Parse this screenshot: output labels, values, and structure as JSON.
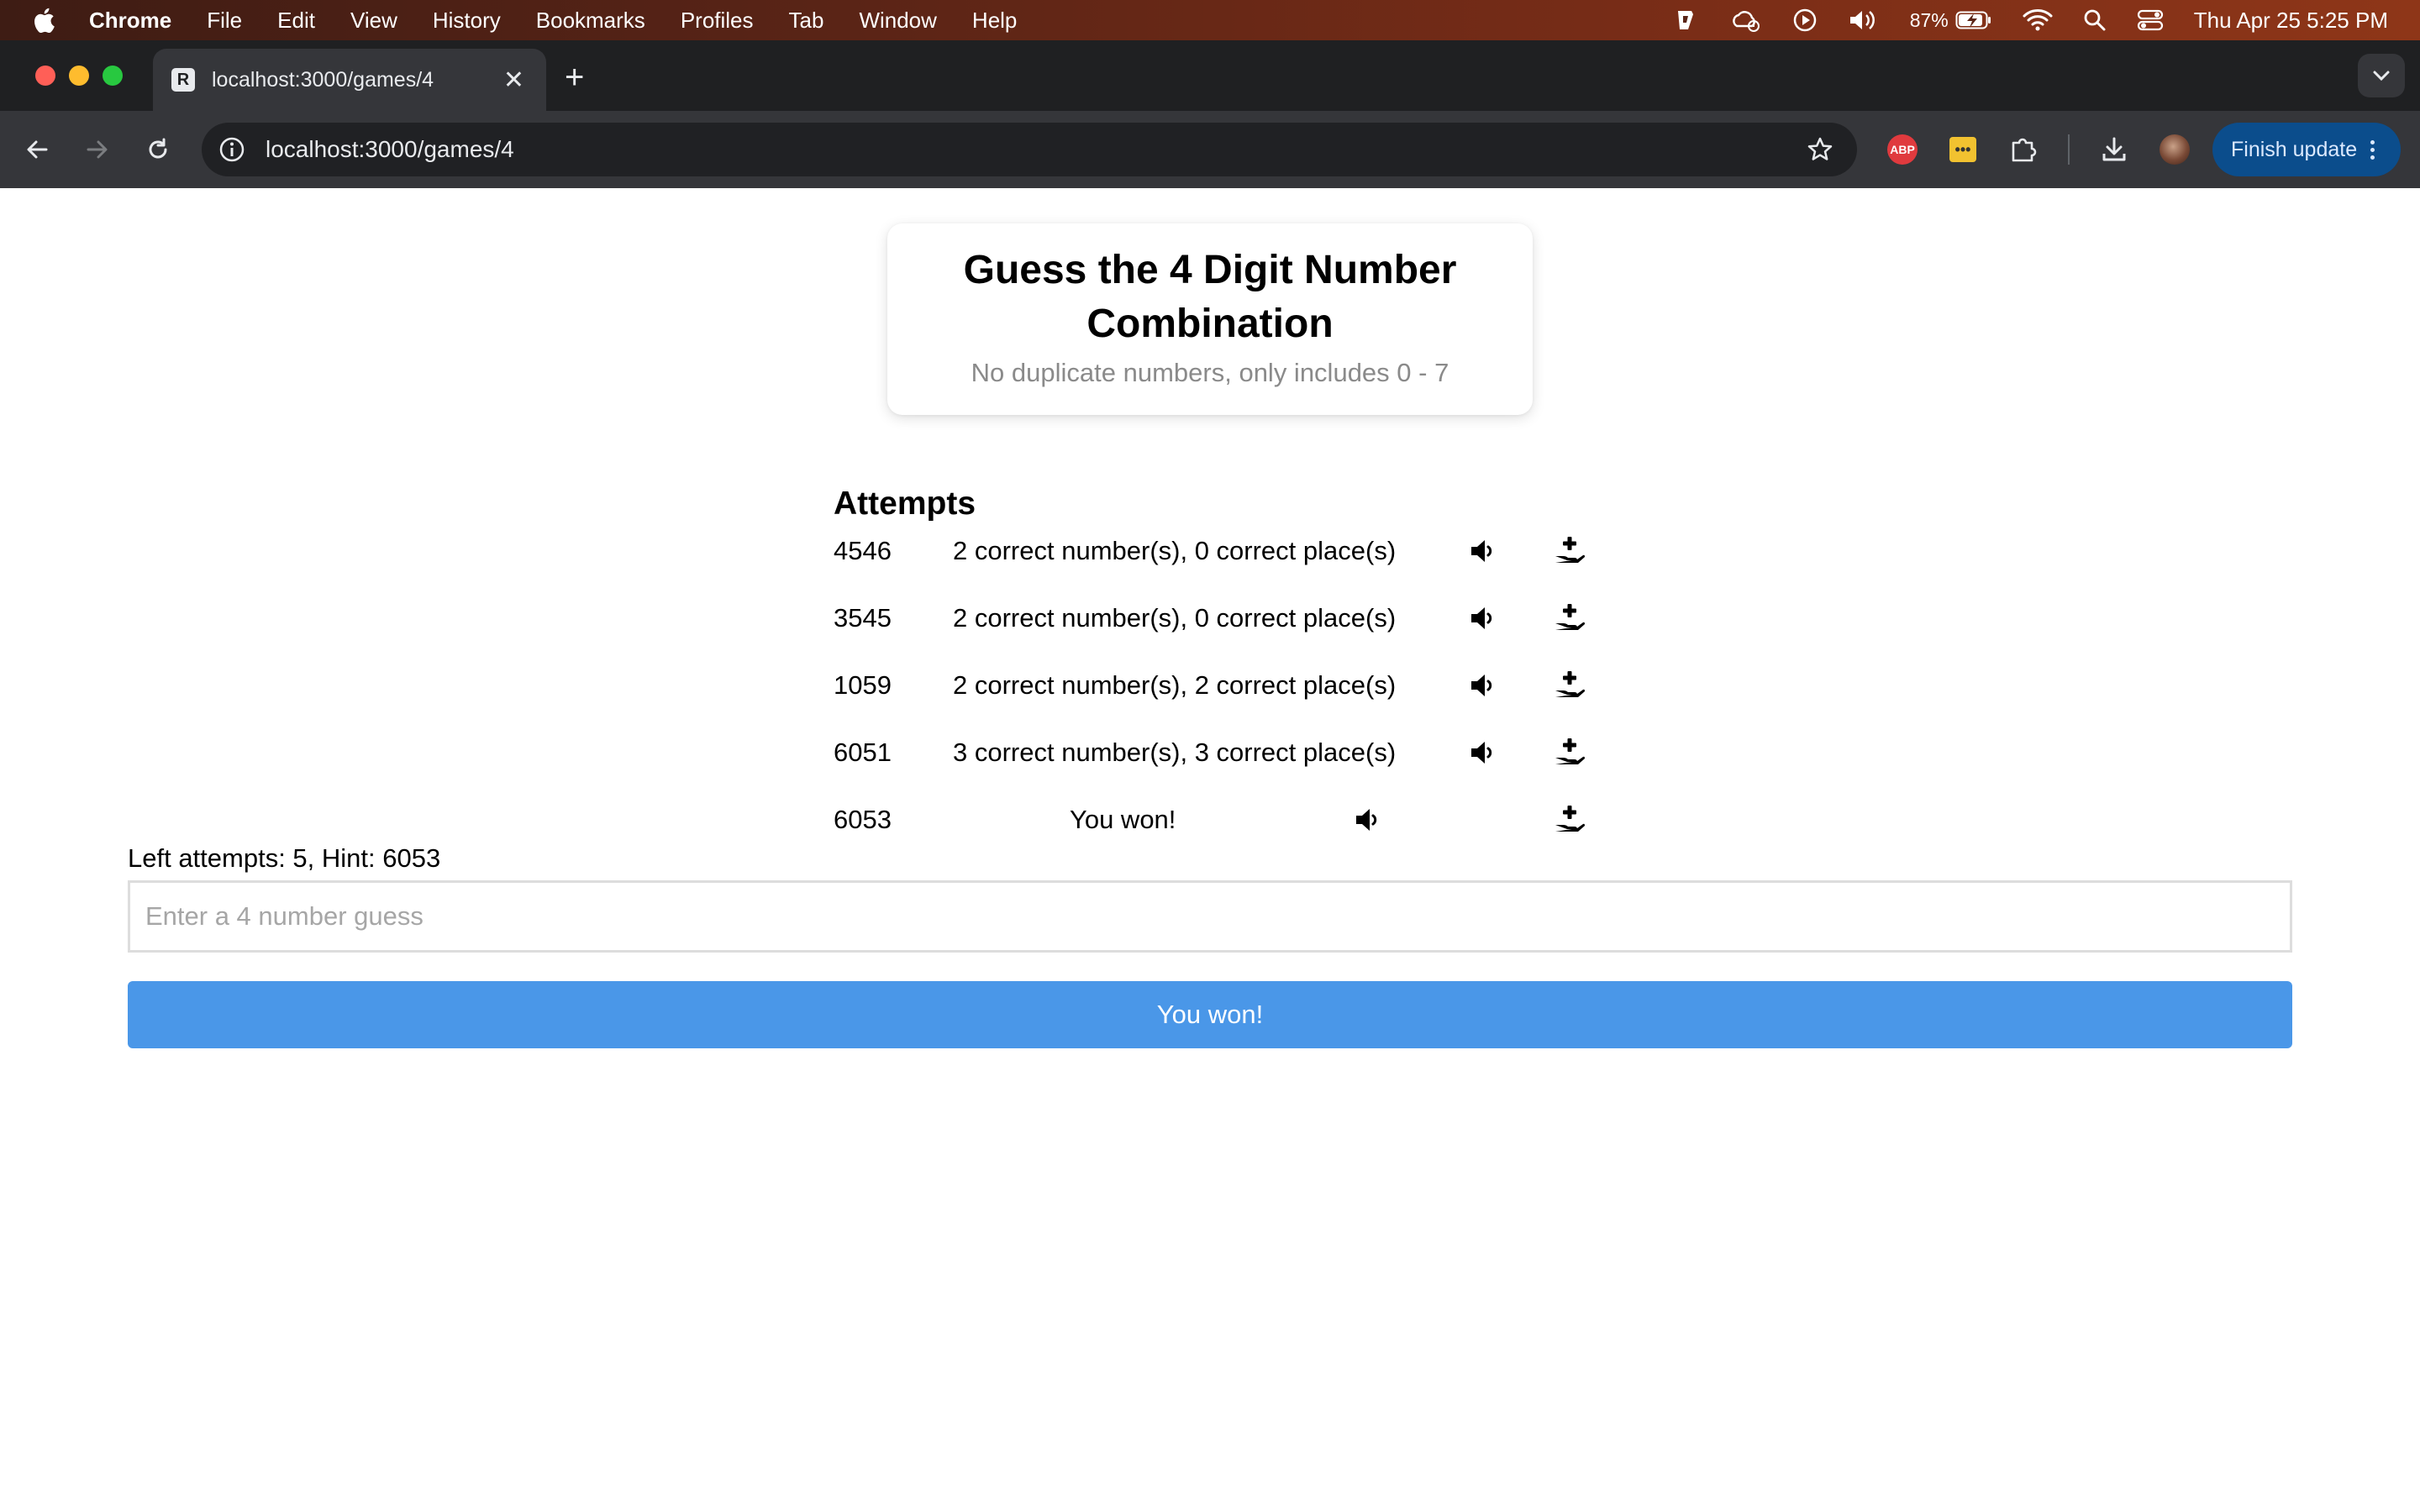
{
  "menubar": {
    "app": "Chrome",
    "items": [
      "File",
      "Edit",
      "View",
      "History",
      "Bookmarks",
      "Profiles",
      "Tab",
      "Window",
      "Help"
    ],
    "battery": "87%",
    "clock": "Thu Apr 25  5:25 PM"
  },
  "browser": {
    "tab_title": "localhost:3000/games/4",
    "tab_favicon_letter": "R",
    "url": "localhost:3000/games/4",
    "abp_label": "ABP",
    "finish_update": "Finish update"
  },
  "game": {
    "title": "Guess the 4 Digit Number Combination",
    "subtitle": "No duplicate numbers, only includes 0 - 7",
    "attempts_heading": "Attempts",
    "attempts": [
      {
        "guess": "4546",
        "result": "2 correct number(s), 0 correct place(s)"
      },
      {
        "guess": "3545",
        "result": "2 correct number(s), 0 correct place(s)"
      },
      {
        "guess": "1059",
        "result": "2 correct number(s), 2 correct place(s)"
      },
      {
        "guess": "6051",
        "result": "3 correct number(s), 3 correct place(s)"
      },
      {
        "guess": "6053",
        "result": "You won!"
      }
    ],
    "status": "Left attempts: 5, Hint: 6053",
    "input_placeholder": "Enter a 4 number guess",
    "input_value": "",
    "submit_label": "You won!"
  },
  "colors": {
    "button": "#4a97e8",
    "finish_update_bg": "#0b4d8c"
  }
}
